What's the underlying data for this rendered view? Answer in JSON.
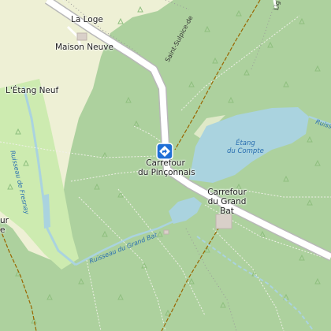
{
  "map": {
    "colors": {
      "forest": "#add19e",
      "farmland": "#eef0d5",
      "meadow": "#cdebb0",
      "water": "#aad3df",
      "road": "#ffffff",
      "road_casing": "#b8b8b8",
      "track": "#996600",
      "marker": "#1f6fd6"
    },
    "places": {
      "la_loge": "La Loge",
      "maison_neuve": "Maison Neuve",
      "letang_neuf": "L'Étang Neuf",
      "carrefour_pinconnais_1": "Carrefour",
      "carrefour_pinconnais_2": "du Pinçonnais",
      "carrefour_grand_bat_1": "Carrefour",
      "carrefour_grand_bat_2": "du Grand",
      "carrefour_grand_bat_3": "Bat",
      "left_edge_1": "ur",
      "left_edge_2": "e"
    },
    "water": {
      "etang_du_compte_1": "Étang",
      "etang_du_compte_2": "du Compte",
      "ruisseau_de_fresnay": "Ruisseau de Fresnay",
      "ruisseau_du_grand_bat": "Ruisseau du Grand Bat",
      "ruisseau_right": "Ruisseau"
    },
    "roads": {
      "saint_sulpice": "Saint-Sulpice-de",
      "road_top_right": "Lig"
    },
    "marker": {
      "icon": "directions-icon"
    }
  }
}
